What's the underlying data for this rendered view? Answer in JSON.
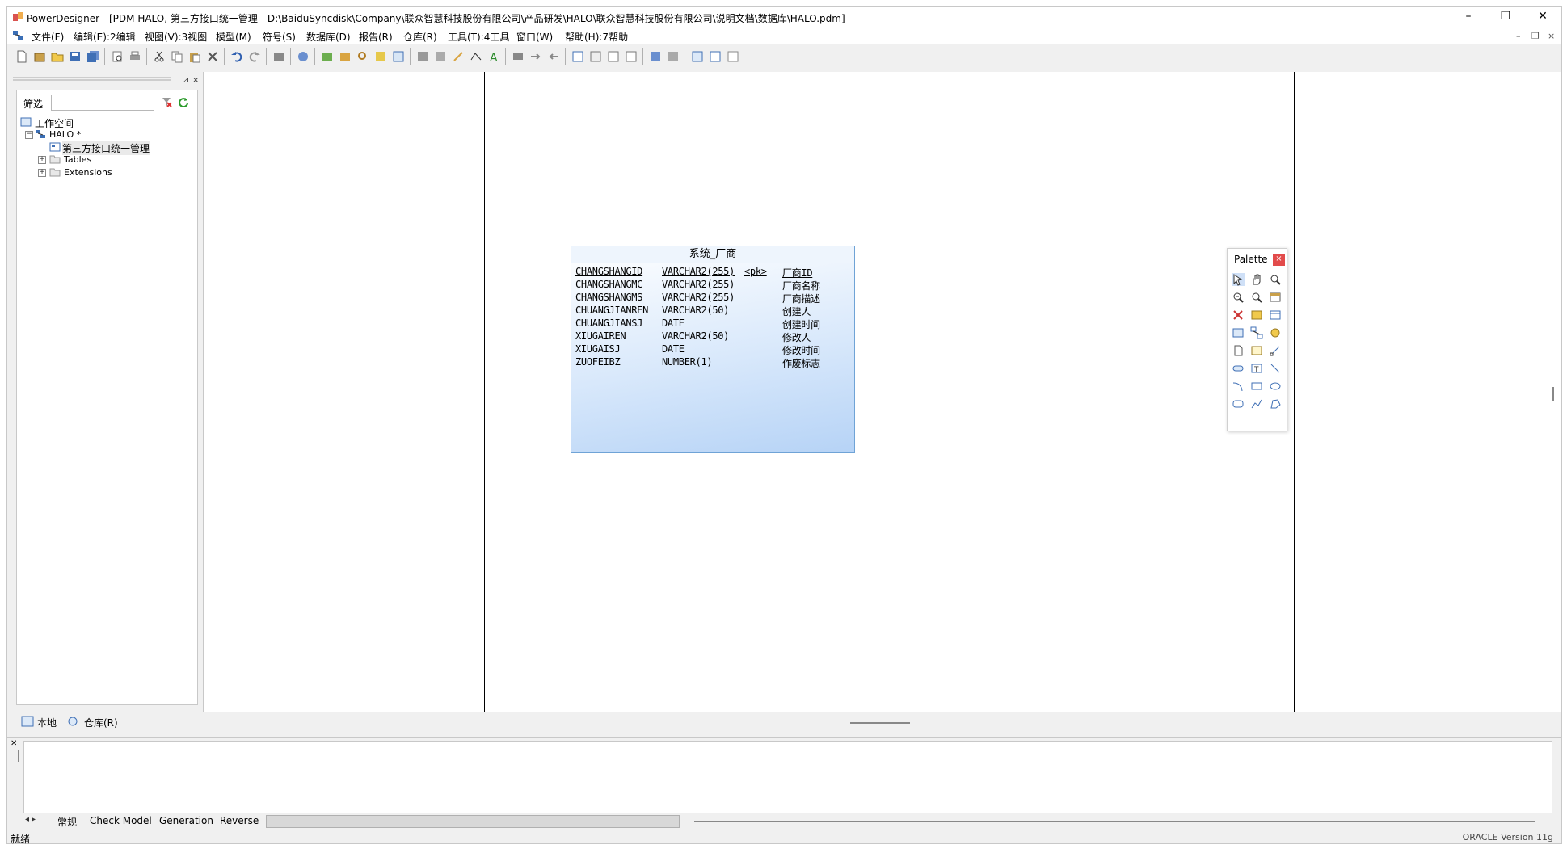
{
  "window": {
    "title": "PowerDesigner - [PDM HALO, 第三方接口统一管理 - D:\\BaiduSyncdisk\\Company\\联众智慧科技股份有限公司\\产品研发\\HALO\\联众智慧科技股份有限公司\\说明文档\\数据库\\HALO.pdm]",
    "minimize": "–",
    "restore": "❐",
    "close": "✕"
  },
  "menu": {
    "items": [
      "文件(F)",
      "编辑(E):2编辑",
      "视图(V):3视图",
      "模型(M)",
      "符号(S)",
      "数据库(D)",
      "报告(R)",
      "仓库(R)",
      "工具(T):4工具",
      "窗口(W)",
      "帮助(H):7帮助"
    ],
    "mdi_min": "–",
    "mdi_restore": "❐",
    "mdi_close": "×"
  },
  "browser": {
    "filter_label": "筛选",
    "filter_value": "",
    "tree": {
      "workspace": "工作空间",
      "model": "HALO *",
      "diagram": "第三方接口统一管理",
      "tables": "Tables",
      "extensions": "Extensions"
    },
    "tabs": [
      "本地",
      "仓库(R)"
    ]
  },
  "entity": {
    "title": "系统_厂商",
    "columns": [
      {
        "name": "CHANGSHANGID",
        "type": "VARCHAR2(255)",
        "key": "<pk>",
        "comment": "厂商ID",
        "pk": true
      },
      {
        "name": "CHANGSHANGMC",
        "type": "VARCHAR2(255)",
        "key": "",
        "comment": "厂商名称",
        "pk": false
      },
      {
        "name": "CHANGSHANGMS",
        "type": "VARCHAR2(255)",
        "key": "",
        "comment": "厂商描述",
        "pk": false
      },
      {
        "name": "CHUANGJIANREN",
        "type": "VARCHAR2(50)",
        "key": "",
        "comment": "创建人",
        "pk": false
      },
      {
        "name": "CHUANGJIANSJ",
        "type": "DATE",
        "key": "",
        "comment": "创建时间",
        "pk": false
      },
      {
        "name": "XIUGAIREN",
        "type": "VARCHAR2(50)",
        "key": "",
        "comment": "修改人",
        "pk": false
      },
      {
        "name": "XIUGAISJ",
        "type": "DATE",
        "key": "",
        "comment": "修改时间",
        "pk": false
      },
      {
        "name": "ZUOFEIBZ",
        "type": "NUMBER(1)",
        "key": "",
        "comment": "作废标志",
        "pk": false
      }
    ]
  },
  "palette": {
    "title": "Palette",
    "close": "×"
  },
  "output": {
    "tabs": [
      "常规",
      "Check Model",
      "Generation",
      "Reverse"
    ]
  },
  "status": {
    "left": "就绪",
    "right": "ORACLE Version 11g"
  },
  "colors": {
    "entity_border": "#6fa3d6",
    "entity_fill": "#cfe3fa",
    "palette_close": "#e24b4b"
  }
}
